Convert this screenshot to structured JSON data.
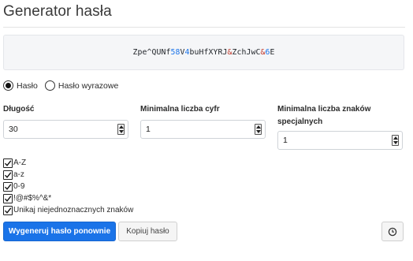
{
  "page": {
    "title": "Generator hasła"
  },
  "password": {
    "segments": [
      {
        "text": "Zpe^QUNf",
        "kind": "plain"
      },
      {
        "text": "58",
        "kind": "number"
      },
      {
        "text": "V",
        "kind": "plain"
      },
      {
        "text": "4",
        "kind": "number"
      },
      {
        "text": "buHfXYRJ",
        "kind": "plain"
      },
      {
        "text": "&",
        "kind": "symbol"
      },
      {
        "text": "ZchJwC",
        "kind": "plain"
      },
      {
        "text": "&",
        "kind": "symbol"
      },
      {
        "text": "6",
        "kind": "number"
      },
      {
        "text": "E",
        "kind": "plain"
      }
    ]
  },
  "mode": {
    "options": [
      {
        "label": "Hasło",
        "selected": true
      },
      {
        "label": "Hasło wyrazowe",
        "selected": false
      }
    ]
  },
  "fields": {
    "length": {
      "label": "Długość",
      "value": "30"
    },
    "min_digits": {
      "label": "Minimalna liczba cyfr",
      "value": "1"
    },
    "min_special": {
      "label": "Minimalna liczba znaków specjalnych",
      "value": "1"
    }
  },
  "options": {
    "uppercase": {
      "label": "A-Z",
      "checked": true
    },
    "lowercase": {
      "label": "a-z",
      "checked": true
    },
    "digits": {
      "label": "0-9",
      "checked": true
    },
    "special": {
      "label": "!@#$%^&*",
      "checked": true
    },
    "avoid_ambiguous": {
      "label": "Unikaj niejednoznacznych znaków",
      "checked": true
    }
  },
  "actions": {
    "regenerate_label": "Wygeneruj hasło ponownie",
    "copy_label": "Kopiuj hasło",
    "history_icon": "clock-icon"
  },
  "colors": {
    "primary": "#1a73e8",
    "number": "#1a73e8",
    "symbol": "#c0392b"
  }
}
